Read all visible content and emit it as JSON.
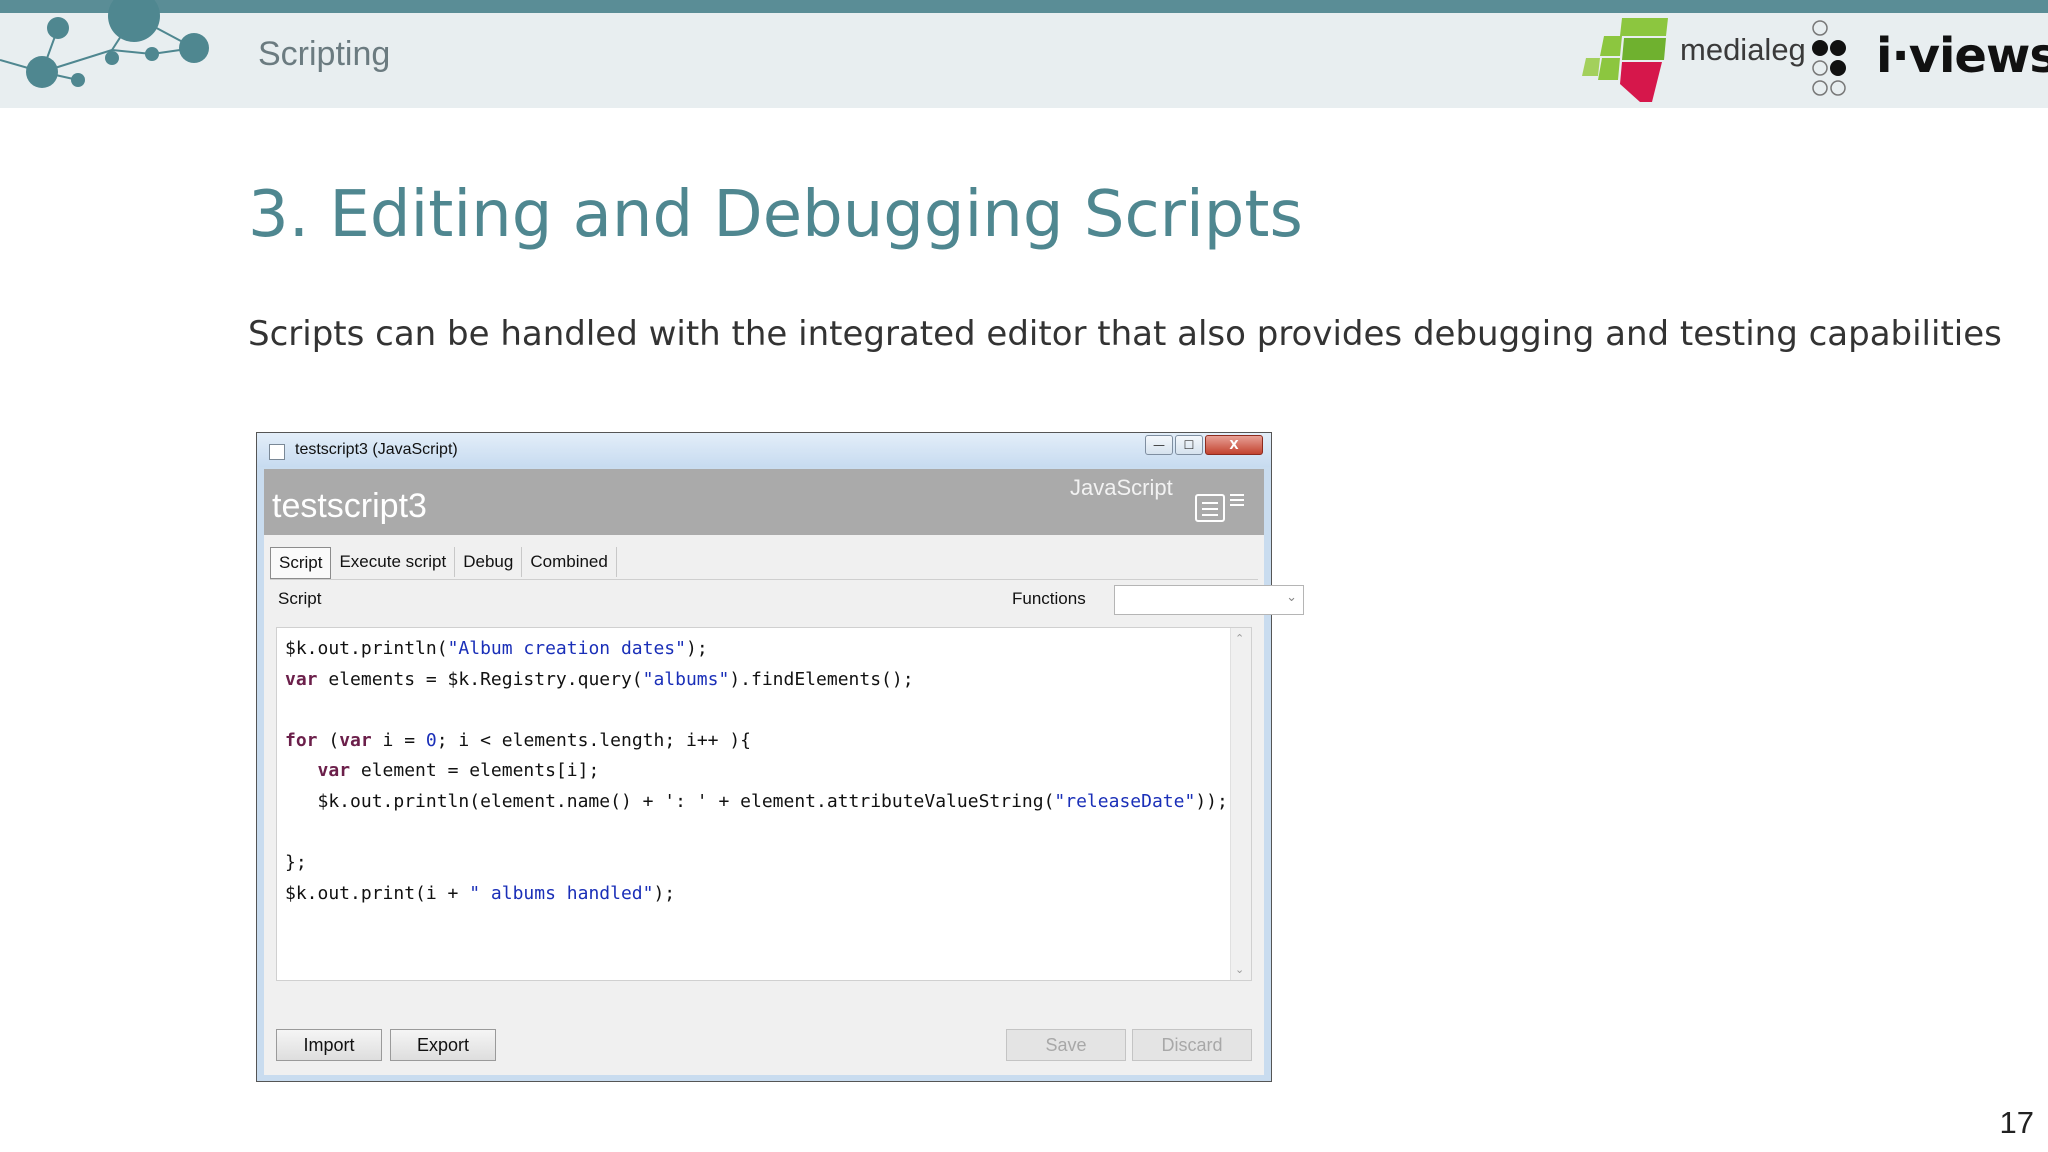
{
  "slide": {
    "section_title": "Scripting",
    "heading": "3. Editing and Debugging Scripts",
    "subtitle": "Scripts can be handled with the integrated editor that also provides debugging and testing capabilities",
    "page_number": "17",
    "logos": {
      "medialeg": "medialeg",
      "iviews": "i·views"
    },
    "colors": {
      "accent": "#4f8790",
      "band": "#e8eef0",
      "topbar": "#5a8d96"
    }
  },
  "window": {
    "title": "testscript3 (JavaScript)",
    "controls": {
      "minimize": "—",
      "maximize": "☐",
      "close": "X"
    },
    "script_name": "testscript3",
    "language": "JavaScript",
    "tabs": [
      "Script",
      "Execute script",
      "Debug",
      "Combined"
    ],
    "script_label": "Script",
    "functions_label": "Functions",
    "functions_value": "",
    "buttons": {
      "import": "Import",
      "export": "Export",
      "save": "Save",
      "discard": "Discard"
    }
  },
  "code": [
    "$k.out.println(\"Album creation dates\");",
    "var elements = $k.Registry.query(\"albums\").findElements();",
    "",
    "for (var i = 0; i < elements.length; i++ ){",
    "   var element = elements[i];",
    "   $k.out.println(element.name() + ': ' + element.attributeValueString(\"releaseDate\"));",
    "",
    "};",
    "$k.out.print(i + \" albums handled\");"
  ]
}
